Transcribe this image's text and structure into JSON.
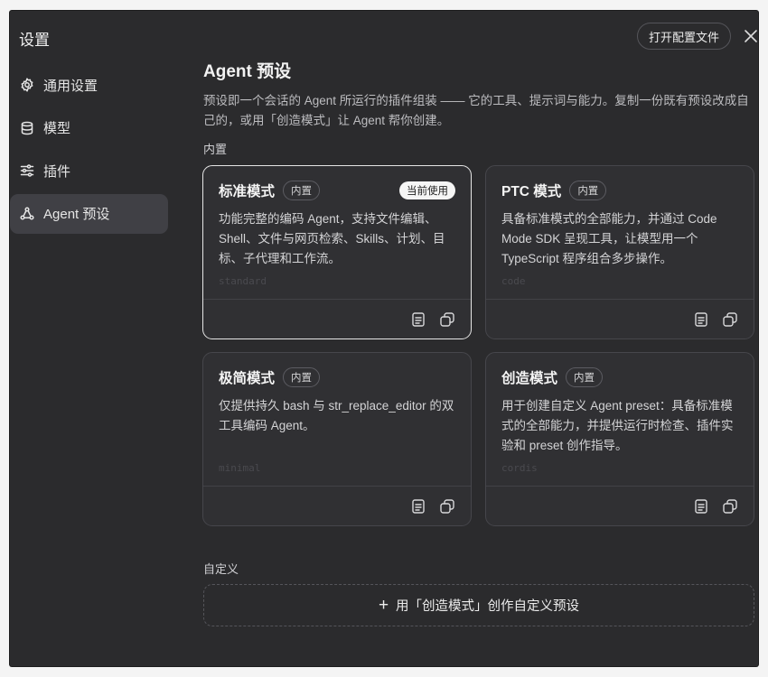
{
  "app_title": "设置",
  "sidebar": {
    "items": [
      {
        "label": "通用设置",
        "icon": "gear-icon"
      },
      {
        "label": "模型",
        "icon": "database-icon"
      },
      {
        "label": "插件",
        "icon": "sliders-icon"
      },
      {
        "label": "Agent 预设",
        "icon": "agent-preset-icon",
        "active": true
      }
    ]
  },
  "header": {
    "open_config_label": "打开配置文件",
    "close_icon": "close-icon"
  },
  "main": {
    "title": "Agent 预设",
    "description": "预设即一个会话的 Agent 所运行的插件组装 —— 它的工具、提示词与能力。复制一份既有预设改成自己的，或用「创造模式」让 Agent 帮你创建。",
    "builtin_label": "内置",
    "custom_label": "自定义",
    "create_button_label": "用「创造模式」创作自定义预设"
  },
  "cards": [
    {
      "name": "标准模式",
      "badge": "内置",
      "current": "当前使用",
      "description": "功能完整的编码 Agent，支持文件编辑、Shell、文件与网页检索、Skills、计划、目标、子代理和工作流。",
      "id": "standard"
    },
    {
      "name": "PTC 模式",
      "badge": "内置",
      "description": "具备标准模式的全部能力，并通过 Code Mode SDK 呈现工具，让模型用一个 TypeScript 程序组合多步操作。",
      "id": "code"
    },
    {
      "name": "极简模式",
      "badge": "内置",
      "description": "仅提供持久 bash 与 str_replace_editor 的双工具编码 Agent。",
      "id": "minimal"
    },
    {
      "name": "创造模式",
      "badge": "内置",
      "description": "用于创建自定义 Agent preset：具备标准模式的全部能力，并提供运行时检查、插件实验和 preset 创作指导。",
      "id": "cordis"
    }
  ],
  "colors": {
    "window_bg": "#2b2b2d",
    "card_bg": "#303033",
    "active_item_bg": "#404045",
    "current_badge_bg": "#f5f5f5"
  }
}
